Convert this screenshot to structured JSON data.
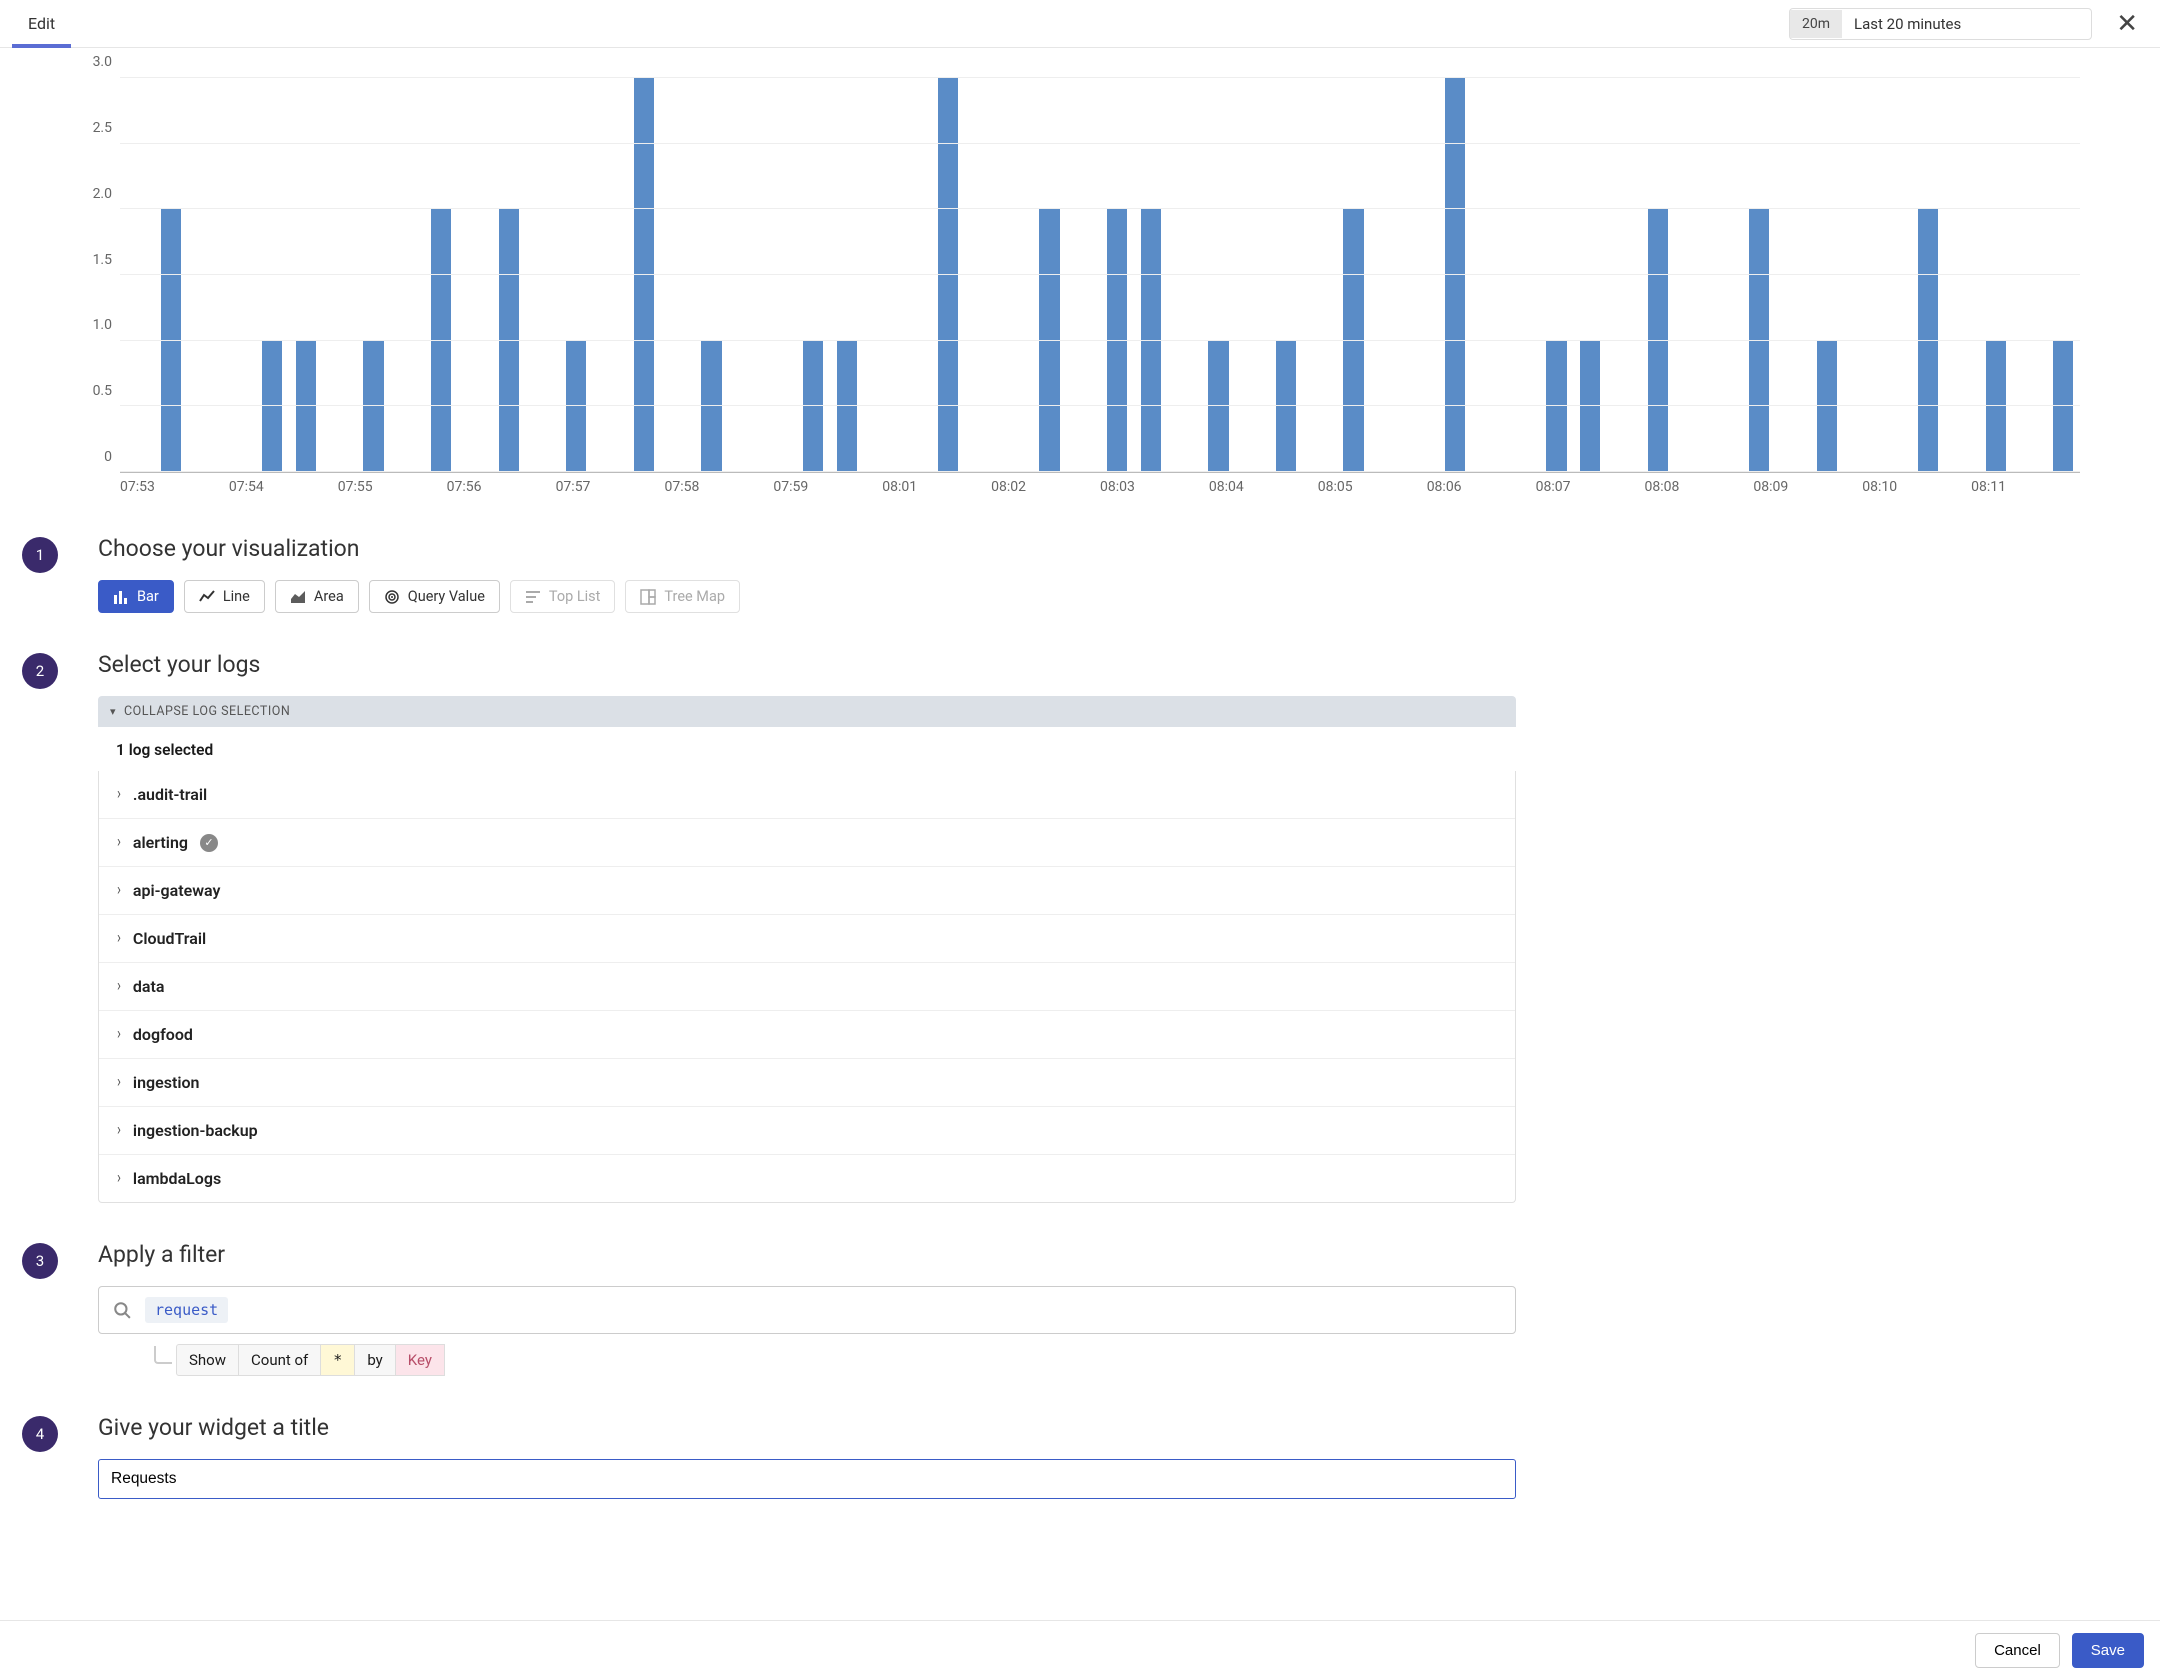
{
  "topbar": {
    "tab_edit_label": "Edit",
    "time_badge": "20m",
    "time_label": "Last 20 minutes"
  },
  "chart_data": {
    "type": "bar",
    "y_ticks": [
      "0",
      "0.5",
      "1.0",
      "1.5",
      "2.0",
      "2.5",
      "3.0"
    ],
    "ymax": 3.0,
    "x_labels": [
      "07:53",
      "07:54",
      "07:55",
      "07:56",
      "07:57",
      "07:58",
      "07:59",
      "08:01",
      "08:02",
      "08:03",
      "08:04",
      "08:05",
      "08:06",
      "08:07",
      "08:08",
      "08:09",
      "08:10",
      "08:11"
    ],
    "values": [
      0,
      2,
      0,
      0,
      1,
      1,
      0,
      1,
      0,
      2,
      0,
      2,
      0,
      1,
      0,
      3,
      0,
      1,
      0,
      0,
      1,
      1,
      0,
      0,
      3,
      0,
      0,
      2,
      0,
      2,
      2,
      0,
      1,
      0,
      1,
      0,
      2,
      0,
      0,
      3,
      0,
      0,
      1,
      1,
      0,
      2,
      0,
      0,
      2,
      0,
      1,
      0,
      0,
      2,
      0,
      1,
      0,
      1
    ]
  },
  "steps": {
    "s1": {
      "num": "1",
      "title": "Choose your visualization"
    },
    "s2": {
      "num": "2",
      "title": "Select your logs"
    },
    "s3": {
      "num": "3",
      "title": "Apply a filter"
    },
    "s4": {
      "num": "4",
      "title": "Give your widget a title"
    }
  },
  "viz": {
    "bar": "Bar",
    "line": "Line",
    "area": "Area",
    "query_value": "Query Value",
    "top_list": "Top List",
    "tree_map": "Tree Map"
  },
  "logs": {
    "collapse_label": "COLLAPSE LOG SELECTION",
    "selected_count_label": "1 log selected",
    "items": [
      {
        "name": ".audit-trail",
        "selected": false
      },
      {
        "name": "alerting",
        "selected": true
      },
      {
        "name": "api-gateway",
        "selected": false
      },
      {
        "name": "CloudTrail",
        "selected": false
      },
      {
        "name": "data",
        "selected": false
      },
      {
        "name": "dogfood",
        "selected": false
      },
      {
        "name": "ingestion",
        "selected": false
      },
      {
        "name": "ingestion-backup",
        "selected": false
      },
      {
        "name": "lambdaLogs",
        "selected": false
      }
    ]
  },
  "filter": {
    "tag": "request",
    "show": "Show",
    "count_of": "Count of",
    "wild": "*",
    "by": "by",
    "key_placeholder": "Key"
  },
  "widget_title": {
    "value": "Requests"
  },
  "footer": {
    "cancel": "Cancel",
    "save": "Save"
  }
}
